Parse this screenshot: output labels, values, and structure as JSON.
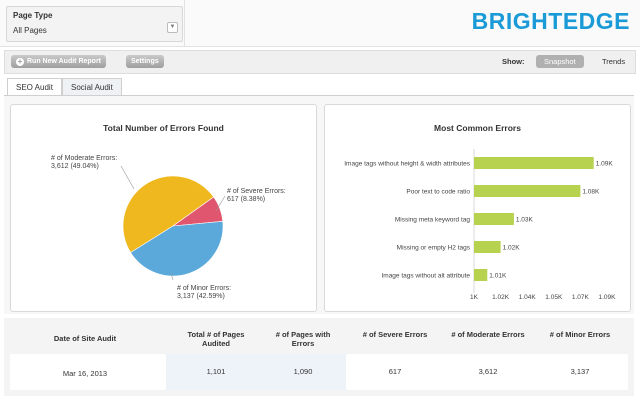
{
  "filter": {
    "label": "Page Type",
    "value": "All Pages"
  },
  "brand": "BRIGHTEDGE",
  "toolbar": {
    "run_audit": "Run New Audit Report",
    "settings": "Settings",
    "show_label": "Show:",
    "snapshot": "Snapshot",
    "trends": "Trends"
  },
  "tabs": [
    {
      "label": "SEO Audit",
      "active": true
    },
    {
      "label": "Social Audit",
      "active": false
    }
  ],
  "pie_chart": {
    "title": "Total Number of Errors Found",
    "chart_data": {
      "type": "pie",
      "slices": [
        {
          "label": "# of Moderate Errors:",
          "value_text": "3,612 (49.04%)",
          "value": 3612,
          "percent": 49.04,
          "color": "#f0b81f"
        },
        {
          "label": "# of Severe Errors:",
          "value_text": "617 (8.38%)",
          "value": 617,
          "percent": 8.38,
          "color": "#e0566e"
        },
        {
          "label": "# of Minor Errors:",
          "value_text": "3,137 (42.59%)",
          "value": 3137,
          "percent": 42.59,
          "color": "#5ba8db"
        }
      ]
    }
  },
  "bar_chart": {
    "title": "Most Common Errors",
    "chart_data": {
      "type": "bar",
      "orientation": "horizontal",
      "categories": [
        "Image tags without height & width attributes",
        "Poor text to code ratio",
        "Missing meta keyword tag",
        "Missing or empty H2 tags",
        "Image tags without alt attribute"
      ],
      "values": [
        1090,
        1080,
        1030,
        1020,
        1010
      ],
      "value_labels": [
        "1.09K",
        "1.08K",
        "1.03K",
        "1.02K",
        "1.01K"
      ],
      "xlim": [
        1000,
        1100
      ],
      "xticks": [
        "1K",
        "1.02K",
        "1.04K",
        "1.05K",
        "1.07K",
        "1.09K"
      ],
      "color": "#b6d24e"
    }
  },
  "table": {
    "headers": [
      "Date of Site Audit",
      "Total # of Pages Audited",
      "# of Pages with Errors",
      "# of Severe Errors",
      "# of Moderate Errors",
      "# of Minor Errors"
    ],
    "rows": [
      [
        "Mar 16, 2013",
        "1,101",
        "1,090",
        "617",
        "3,612",
        "3,137"
      ]
    ]
  }
}
